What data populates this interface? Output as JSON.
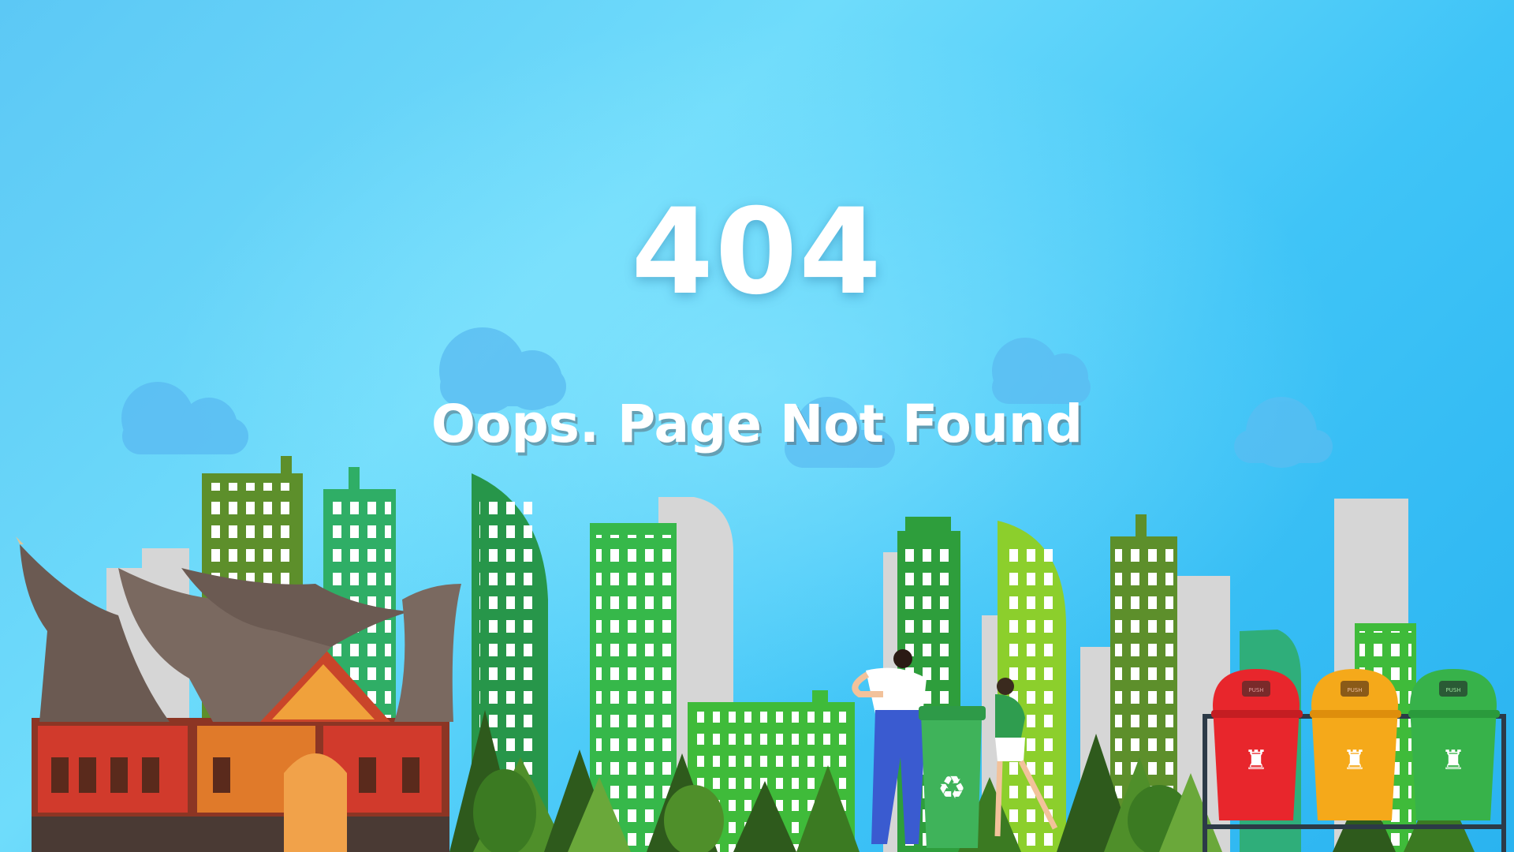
{
  "error": {
    "code": "404",
    "message": "Oops. Page Not Found"
  },
  "bins": {
    "lid_label": "PUSH",
    "colors": [
      "#e8262c",
      "#f5a91a",
      "#37b24a"
    ]
  },
  "colors": {
    "sky_top": "#2ab3f0",
    "sky_light": "#6fdcfb",
    "cloud": "#5bbdf2",
    "building_greens": [
      "#6a9a2e",
      "#2fae66",
      "#27964a",
      "#8ccf2c",
      "#36b84a"
    ],
    "building_grey": "#d6d6d6"
  },
  "icons": {
    "recycle": "recycle-icon",
    "trash": "trash-person-icon"
  }
}
